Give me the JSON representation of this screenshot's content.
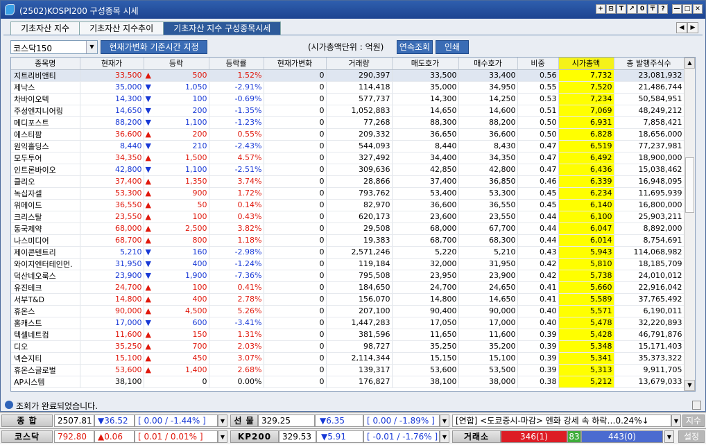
{
  "window": {
    "title": "(2502)KOSPI200 구성종목 시세",
    "buttons": [
      "+",
      "⊡",
      "T",
      "↗",
      "0",
      "〒",
      "?",
      "—",
      "□",
      "✕"
    ]
  },
  "tabs": [
    {
      "label": "기초자산 지수",
      "active": false
    },
    {
      "label": "기초자산 지수추이",
      "active": false
    },
    {
      "label": "기초자산 지수 구성종목시세",
      "active": true
    }
  ],
  "tab_nav": [
    "◀",
    "▶"
  ],
  "toolbar": {
    "market_select": "코스닥150",
    "base_time_button": "현재가변화 기준시간 지정",
    "unit_label": "(시가총액단위 : 억원)",
    "continuous_button": "연속조회",
    "print_button": "인쇄"
  },
  "table": {
    "headers": [
      "종목명",
      "현재가",
      "등락",
      "등락률",
      "현재가변화",
      "거래량",
      "매도호가",
      "매수호가",
      "비중",
      "시가총액",
      "총 발행주식수"
    ],
    "rows": [
      {
        "name": "지트리비앤티",
        "price": "33,500",
        "dir": "up",
        "chg": "500",
        "rate": "1.52%",
        "pchg": "0",
        "vol": "290,397",
        "ask": "33,500",
        "bid": "33,400",
        "weight": "0.56",
        "cap": "7,732",
        "shares": "23,081,932"
      },
      {
        "name": "제낙스",
        "price": "35,000",
        "dir": "dn",
        "chg": "1,050",
        "rate": "-2.91%",
        "pchg": "0",
        "vol": "114,418",
        "ask": "35,000",
        "bid": "34,950",
        "weight": "0.55",
        "cap": "7,520",
        "shares": "21,486,744"
      },
      {
        "name": "차바이오텍",
        "price": "14,300",
        "dir": "dn",
        "chg": "100",
        "rate": "-0.69%",
        "pchg": "0",
        "vol": "577,737",
        "ask": "14,300",
        "bid": "14,250",
        "weight": "0.53",
        "cap": "7,234",
        "shares": "50,584,951"
      },
      {
        "name": "주성엔지니어링",
        "price": "14,650",
        "dir": "dn",
        "chg": "200",
        "rate": "-1.35%",
        "pchg": "0",
        "vol": "1,052,883",
        "ask": "14,650",
        "bid": "14,600",
        "weight": "0.51",
        "cap": "7,069",
        "shares": "48,249,212"
      },
      {
        "name": "메디포스트",
        "price": "88,200",
        "dir": "dn",
        "chg": "1,100",
        "rate": "-1.23%",
        "pchg": "0",
        "vol": "77,268",
        "ask": "88,300",
        "bid": "88,200",
        "weight": "0.50",
        "cap": "6,931",
        "shares": "7,858,421"
      },
      {
        "name": "에스티팜",
        "price": "36,600",
        "dir": "up",
        "chg": "200",
        "rate": "0.55%",
        "pchg": "0",
        "vol": "209,332",
        "ask": "36,650",
        "bid": "36,600",
        "weight": "0.50",
        "cap": "6,828",
        "shares": "18,656,000"
      },
      {
        "name": "원익홀딩스",
        "price": "8,440",
        "dir": "dn",
        "chg": "210",
        "rate": "-2.43%",
        "pchg": "0",
        "vol": "544,093",
        "ask": "8,440",
        "bid": "8,430",
        "weight": "0.47",
        "cap": "6,519",
        "shares": "77,237,981"
      },
      {
        "name": "모두투어",
        "price": "34,350",
        "dir": "up",
        "chg": "1,500",
        "rate": "4.57%",
        "pchg": "0",
        "vol": "327,492",
        "ask": "34,400",
        "bid": "34,350",
        "weight": "0.47",
        "cap": "6,492",
        "shares": "18,900,000"
      },
      {
        "name": "인트론바이오",
        "price": "42,800",
        "dir": "dn",
        "chg": "1,100",
        "rate": "-2.51%",
        "pchg": "0",
        "vol": "309,636",
        "ask": "42,850",
        "bid": "42,800",
        "weight": "0.47",
        "cap": "6,436",
        "shares": "15,038,462"
      },
      {
        "name": "클리오",
        "price": "37,400",
        "dir": "up",
        "chg": "1,350",
        "rate": "3.74%",
        "pchg": "0",
        "vol": "28,866",
        "ask": "37,400",
        "bid": "36,850",
        "weight": "0.46",
        "cap": "6,339",
        "shares": "16,948,095"
      },
      {
        "name": "녹십자셀",
        "price": "53,300",
        "dir": "up",
        "chg": "900",
        "rate": "1.72%",
        "pchg": "0",
        "vol": "793,762",
        "ask": "53,400",
        "bid": "53,300",
        "weight": "0.45",
        "cap": "6,234",
        "shares": "11,695,939"
      },
      {
        "name": "위메이드",
        "price": "36,550",
        "dir": "up",
        "chg": "50",
        "rate": "0.14%",
        "pchg": "0",
        "vol": "82,970",
        "ask": "36,600",
        "bid": "36,550",
        "weight": "0.45",
        "cap": "6,140",
        "shares": "16,800,000"
      },
      {
        "name": "크리스탈",
        "price": "23,550",
        "dir": "up",
        "chg": "100",
        "rate": "0.43%",
        "pchg": "0",
        "vol": "620,173",
        "ask": "23,600",
        "bid": "23,550",
        "weight": "0.44",
        "cap": "6,100",
        "shares": "25,903,211"
      },
      {
        "name": "동국제약",
        "price": "68,000",
        "dir": "up",
        "chg": "2,500",
        "rate": "3.82%",
        "pchg": "0",
        "vol": "29,508",
        "ask": "68,000",
        "bid": "67,700",
        "weight": "0.44",
        "cap": "6,047",
        "shares": "8,892,000"
      },
      {
        "name": "나스미디어",
        "price": "68,700",
        "dir": "up",
        "chg": "800",
        "rate": "1.18%",
        "pchg": "0",
        "vol": "19,383",
        "ask": "68,700",
        "bid": "68,300",
        "weight": "0.44",
        "cap": "6,014",
        "shares": "8,754,691"
      },
      {
        "name": "제이콘텐트리",
        "price": "5,210",
        "dir": "dn",
        "chg": "160",
        "rate": "-2.98%",
        "pchg": "0",
        "vol": "2,571,246",
        "ask": "5,220",
        "bid": "5,210",
        "weight": "0.43",
        "cap": "5,943",
        "shares": "114,068,982"
      },
      {
        "name": "와이지엔터테인먼.",
        "price": "31,950",
        "dir": "dn",
        "chg": "400",
        "rate": "-1.24%",
        "pchg": "0",
        "vol": "119,184",
        "ask": "32,000",
        "bid": "31,950",
        "weight": "0.42",
        "cap": "5,810",
        "shares": "18,185,709"
      },
      {
        "name": "덕산네오룩스",
        "price": "23,900",
        "dir": "dn",
        "chg": "1,900",
        "rate": "-7.36%",
        "pchg": "0",
        "vol": "795,508",
        "ask": "23,950",
        "bid": "23,900",
        "weight": "0.42",
        "cap": "5,738",
        "shares": "24,010,012"
      },
      {
        "name": "유진테크",
        "price": "24,700",
        "dir": "up",
        "chg": "100",
        "rate": "0.41%",
        "pchg": "0",
        "vol": "184,650",
        "ask": "24,700",
        "bid": "24,650",
        "weight": "0.41",
        "cap": "5,660",
        "shares": "22,916,042"
      },
      {
        "name": "서부T&D",
        "price": "14,800",
        "dir": "up",
        "chg": "400",
        "rate": "2.78%",
        "pchg": "0",
        "vol": "156,070",
        "ask": "14,800",
        "bid": "14,650",
        "weight": "0.41",
        "cap": "5,589",
        "shares": "37,765,492"
      },
      {
        "name": "휴온스",
        "price": "90,000",
        "dir": "up",
        "chg": "4,500",
        "rate": "5.26%",
        "pchg": "0",
        "vol": "207,100",
        "ask": "90,400",
        "bid": "90,000",
        "weight": "0.40",
        "cap": "5,571",
        "shares": "6,190,011"
      },
      {
        "name": "홈캐스트",
        "price": "17,000",
        "dir": "dn",
        "chg": "600",
        "rate": "-3.41%",
        "pchg": "0",
        "vol": "1,447,283",
        "ask": "17,050",
        "bid": "17,000",
        "weight": "0.40",
        "cap": "5,478",
        "shares": "32,220,893"
      },
      {
        "name": "텍셀네트컴",
        "price": "11,600",
        "dir": "up",
        "chg": "150",
        "rate": "1.31%",
        "pchg": "0",
        "vol": "381,596",
        "ask": "11,650",
        "bid": "11,600",
        "weight": "0.39",
        "cap": "5,428",
        "shares": "46,791,876"
      },
      {
        "name": "디오",
        "price": "35,250",
        "dir": "up",
        "chg": "700",
        "rate": "2.03%",
        "pchg": "0",
        "vol": "98,727",
        "ask": "35,250",
        "bid": "35,200",
        "weight": "0.39",
        "cap": "5,348",
        "shares": "15,171,403"
      },
      {
        "name": "넥슨지티",
        "price": "15,100",
        "dir": "up",
        "chg": "450",
        "rate": "3.07%",
        "pchg": "0",
        "vol": "2,114,344",
        "ask": "15,150",
        "bid": "15,100",
        "weight": "0.39",
        "cap": "5,341",
        "shares": "35,373,322"
      },
      {
        "name": "휴온스글로벌",
        "price": "53,600",
        "dir": "up",
        "chg": "1,400",
        "rate": "2.68%",
        "pchg": "0",
        "vol": "139,317",
        "ask": "53,600",
        "bid": "53,500",
        "weight": "0.39",
        "cap": "5,313",
        "shares": "9,911,705"
      },
      {
        "name": "AP시스템",
        "price": "38,100",
        "dir": "flat",
        "chg": "0",
        "rate": "0.00%",
        "pchg": "0",
        "vol": "176,827",
        "ask": "38,100",
        "bid": "38,000",
        "weight": "0.38",
        "cap": "5,212",
        "shares": "13,679,033"
      }
    ]
  },
  "status": {
    "message": "조회가 완료되었습니다."
  },
  "ticker1": {
    "label1": "종 합",
    "v1": "2507.81",
    "d1": "▼36.52",
    "r1": "[ 0.00  / -1.44% ]",
    "label2": "선 물",
    "v2": "329.25",
    "d2": "▼6.35",
    "r2": "[ 0.00  / -1.89% ]",
    "news": "[연합] <도쿄증시-마감> 엔화 강세 속 하락…0.24%↓",
    "btn": "지수"
  },
  "ticker2": {
    "label1": "코스닥",
    "v1": "792.80",
    "d1": "▲0.06",
    "r1": "[ 0.01  / 0.01% ]",
    "label2": "KP200",
    "v2": "329.53",
    "d2": "▼5.91",
    "r2": "[ -0.01 / -1.76% ]",
    "label3": "거래소",
    "up": "346(1)",
    "flat": "83",
    "down": "443(0)",
    "btn": "설정"
  },
  "colors": {
    "up": "#e0180c",
    "down": "#1839d6",
    "highlight": "#ffff00",
    "title": "#2f5fae"
  }
}
